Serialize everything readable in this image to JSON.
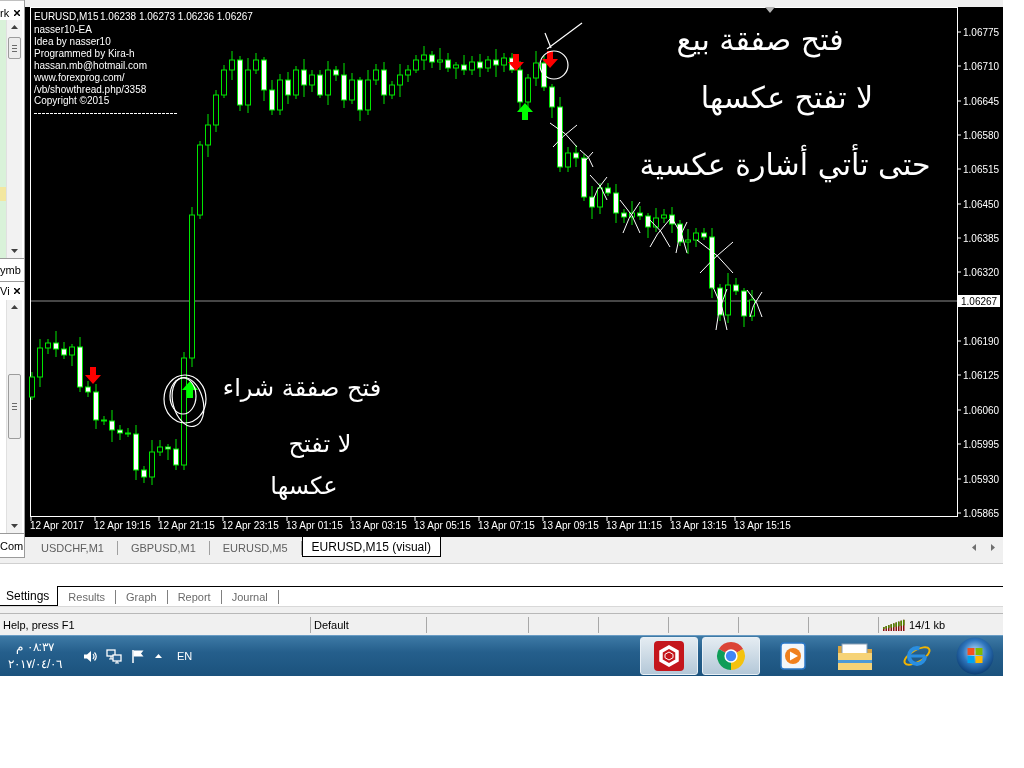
{
  "side_panels": [
    {
      "title": "rk",
      "tab": "ymb"
    },
    {
      "title": "Vi",
      "tab": "Com"
    }
  ],
  "chart": {
    "symbol": "EURUSD,M15",
    "ohlc": "1.06238 1.06273 1.06236 1.06267",
    "comment_lines": [
      "nasser10-EA",
      "Idea by nasser10",
      "Programmed by Kira-h",
      "hassan.mb@hotmail.com",
      "www.forexprog.com/",
      "/vb/showthread.php/3358",
      "Copyright ©2015"
    ],
    "price_labels": [
      "1.06775",
      "1.06710",
      "1.06645",
      "1.06580",
      "1.06515",
      "1.06450",
      "1.06385",
      "1.06320",
      "1.06190",
      "1.06125",
      "1.06060",
      "1.05995",
      "1.05930",
      "1.05865"
    ],
    "current_price": "1.06267",
    "time_labels": [
      "12 Apr 2017",
      "12 Apr 19:15",
      "12 Apr 21:15",
      "12 Apr 23:15",
      "13 Apr 01:15",
      "13 Apr 03:15",
      "13 Apr 05:15",
      "13 Apr 07:15",
      "13 Apr 09:15",
      "13 Apr 11:15",
      "13 Apr 13:15",
      "13 Apr 15:15"
    ],
    "handwritten_notes": [
      {
        "lines": [
          "فتح صفقة بيع",
          "لا تفتح عكسها",
          "حتى تأتي أشارة عكسية"
        ]
      },
      {
        "lines": [
          "فتح صفقة شراء",
          "لا تفتح",
          "عكسها"
        ]
      }
    ]
  },
  "chart_tabs": [
    {
      "label": "USDCHF,M1",
      "selected": false
    },
    {
      "label": "GBPUSD,M1",
      "selected": false
    },
    {
      "label": "EURUSD,M5",
      "selected": false
    },
    {
      "label": "EURUSD,M15 (visual)",
      "selected": true
    }
  ],
  "tester_tabs": [
    {
      "label": "Settings",
      "selected": true
    },
    {
      "label": "Results",
      "selected": false
    },
    {
      "label": "Graph",
      "selected": false
    },
    {
      "label": "Report",
      "selected": false
    },
    {
      "label": "Journal",
      "selected": false
    }
  ],
  "status_bar": {
    "help": "Help, press F1",
    "profile": "Default",
    "traffic": "14/1 kb"
  },
  "taskbar": {
    "time": "٠٨:٣٧ م",
    "date": "٢٠١٧/٠٤/٠٦",
    "language": "EN",
    "buttons": [
      {
        "kind": "hexagon",
        "open": true
      },
      {
        "kind": "circle",
        "open": true
      },
      {
        "kind": "play",
        "open": false
      },
      {
        "kind": "folder",
        "open": false
      },
      {
        "kind": "ring",
        "open": false
      }
    ]
  }
}
